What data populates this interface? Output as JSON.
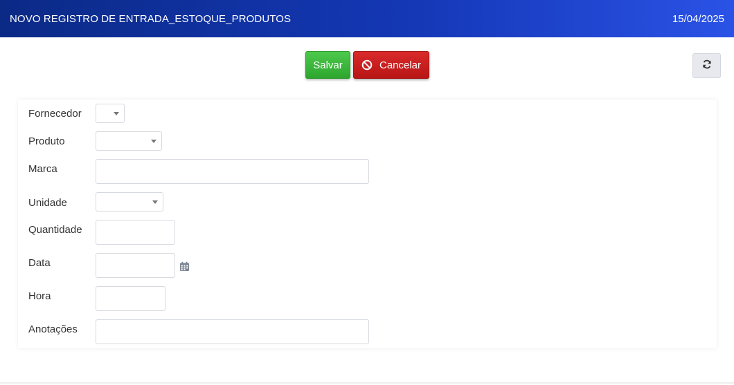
{
  "header": {
    "title": "NOVO REGISTRO DE ENTRADA_ESTOQUE_PRODUTOS",
    "date": "15/04/2025"
  },
  "toolbar": {
    "save_label": "Salvar",
    "cancel_label": "Cancelar",
    "cancel_icon": "ban-icon",
    "refresh_icon": "refresh-icon"
  },
  "form": {
    "fornecedor_label": "Fornecedor",
    "fornecedor_value": "",
    "produto_label": "Produto",
    "produto_value": "",
    "marca_label": "Marca",
    "marca_value": "",
    "unidade_label": "Unidade",
    "unidade_value": "",
    "quantidade_label": "Quantidade",
    "quantidade_value": "",
    "data_label": "Data",
    "data_value": "",
    "data_icon": "calendar-icon",
    "hora_label": "Hora",
    "hora_value": "",
    "anotacoes_label": "Anotações",
    "anotacoes_value": ""
  },
  "colors": {
    "header_start": "#0b2a86",
    "header_end": "#2a52e6",
    "save": "#2ea62e",
    "cancel": "#c41b1b"
  }
}
